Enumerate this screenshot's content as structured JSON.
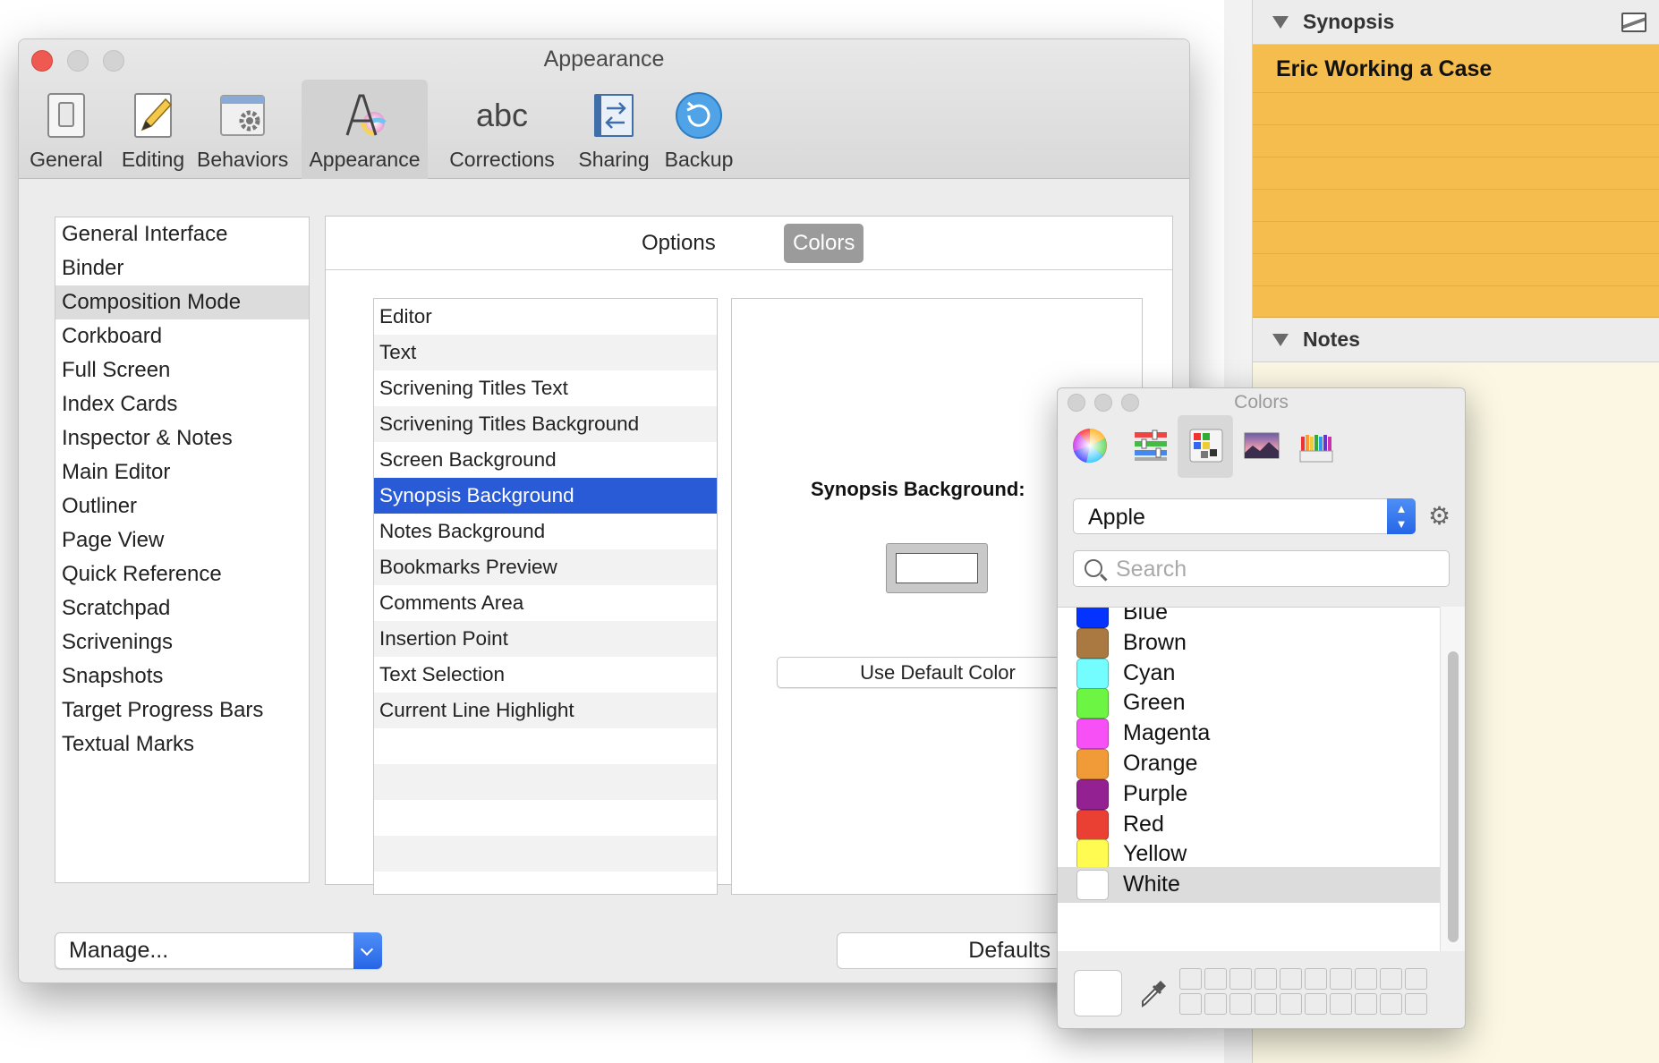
{
  "inspector": {
    "synopsis_header": "Synopsis",
    "synopsis_title": "Eric Working a Case",
    "notes_header": "Notes"
  },
  "prefs": {
    "title": "Appearance",
    "toolbar": [
      {
        "label": "General",
        "icon": "general-icon"
      },
      {
        "label": "Editing",
        "icon": "editing-icon"
      },
      {
        "label": "Behaviors",
        "icon": "behaviors-icon"
      },
      {
        "label": "Appearance",
        "icon": "appearance-icon"
      },
      {
        "label": "Corrections",
        "icon": "corrections-icon"
      },
      {
        "label": "Sharing",
        "icon": "sharing-icon"
      },
      {
        "label": "Backup",
        "icon": "backup-icon"
      }
    ],
    "corrections_icon_text": "abc",
    "active_tool": "Appearance",
    "categories": [
      "General Interface",
      "Binder",
      "Composition Mode",
      "Corkboard",
      "Full Screen",
      "Index Cards",
      "Inspector & Notes",
      "Main Editor",
      "Outliner",
      "Page View",
      "Quick Reference",
      "Scratchpad",
      "Scrivenings",
      "Snapshots",
      "Target Progress Bars",
      "Textual Marks"
    ],
    "selected_category": "Composition Mode",
    "segments": {
      "options": "Options",
      "colors": "Colors",
      "active": "Colors"
    },
    "elements": [
      "Editor",
      "Text",
      "Scrivening Titles Text",
      "Scrivening Titles Background",
      "Screen Background",
      "Synopsis Background",
      "Notes Background",
      "Bookmarks Preview",
      "Comments Area",
      "Insertion Point",
      "Text Selection",
      "Current Line Highlight"
    ],
    "selected_element": "Synopsis Background",
    "preview_label": "Synopsis Background:",
    "use_default_label": "Use Default Color",
    "manage_label": "Manage...",
    "defaults_label": "Defaults"
  },
  "colors_panel": {
    "title": "Colors",
    "tabs": [
      "color-wheel-icon",
      "sliders-icon",
      "palettes-icon",
      "image-palette-icon",
      "pencils-icon"
    ],
    "active_tab": "palettes-icon",
    "palette": "Apple",
    "search_placeholder": "Search",
    "swatches": [
      {
        "name": "Blue",
        "color": "#0433ff"
      },
      {
        "name": "Brown",
        "color": "#aa7942"
      },
      {
        "name": "Cyan",
        "color": "#73fdff"
      },
      {
        "name": "Green",
        "color": "#6cf543"
      },
      {
        "name": "Magenta",
        "color": "#f750f7"
      },
      {
        "name": "Orange",
        "color": "#f19a38"
      },
      {
        "name": "Purple",
        "color": "#942192"
      },
      {
        "name": "Red",
        "color": "#ea3f33"
      },
      {
        "name": "Yellow",
        "color": "#fffb51"
      },
      {
        "name": "White",
        "color": "#ffffff"
      }
    ],
    "selected_swatch": "White",
    "current_color": "#ffffff"
  },
  "colors": {
    "synopsis_card": "#f5bd4d",
    "selection_blue": "#2a5bd7",
    "close_red": "#ee5a52"
  }
}
